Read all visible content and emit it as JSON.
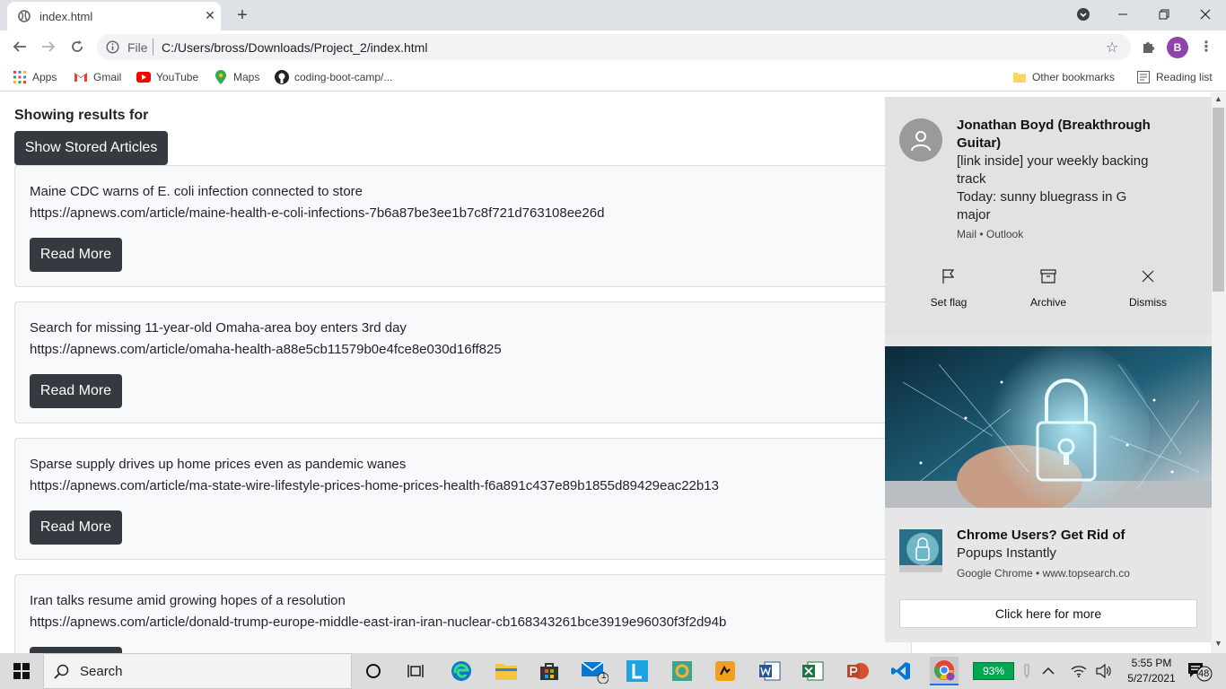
{
  "browser": {
    "tab_title": "index.html",
    "omnibox": {
      "scheme": "File",
      "url": "C:/Users/bross/Downloads/Project_2/index.html"
    },
    "profile_initial": "B",
    "bookmarks": {
      "apps": "Apps",
      "gmail": "Gmail",
      "youtube": "YouTube",
      "maps": "Maps",
      "github": "coding-boot-camp/...",
      "other": "Other bookmarks",
      "reading": "Reading list"
    }
  },
  "page": {
    "results_label": "Showing results for",
    "show_stored_label": "Show Stored Articles",
    "read_more_label": "Read More",
    "articles": [
      {
        "title": "Maine CDC warns of E. coli infection connected to store",
        "url": "https://apnews.com/article/maine-health-e-coli-infections-7b6a87be3ee1b7c8f721d763108ee26d"
      },
      {
        "title": "Search for missing 11-year-old Omaha-area boy enters 3rd day",
        "url": "https://apnews.com/article/omaha-health-a88e5cb11579b0e4fce8e030d16ff825"
      },
      {
        "title": "Sparse supply drives up home prices even as pandemic wanes",
        "url": "https://apnews.com/article/ma-state-wire-lifestyle-prices-home-prices-health-f6a891c437e89b1855d89429eac22b13"
      },
      {
        "title": "Iran talks resume amid growing hopes of a resolution",
        "url": "https://apnews.com/article/donald-trump-europe-middle-east-iran-iran-nuclear-cb168343261bce3919e96030f3f2d94b"
      }
    ]
  },
  "notification": {
    "sender": "Jonathan Boyd (Breakthrough Guitar)",
    "subject": "[link inside] your weekly backing track",
    "preview": "Today: sunny bluegrass in G major",
    "app": "Mail • Outlook",
    "actions": {
      "flag": "Set flag",
      "archive": "Archive",
      "dismiss": "Dismiss"
    },
    "ad": {
      "title": "Chrome Users? Get Rid of",
      "subtitle": "Popups Instantly",
      "source": "Google Chrome • www.topsearch.co",
      "button": "Click here for more"
    }
  },
  "taskbar": {
    "search_placeholder": "Search",
    "battery": "93%",
    "mail_badge": "1",
    "time": "5:55 PM",
    "date": "5/27/2021",
    "notification_count": "48"
  },
  "colors": {
    "button_dark": "#343a40",
    "card_bg": "#f8f9fa",
    "battery_green": "#00a651"
  }
}
